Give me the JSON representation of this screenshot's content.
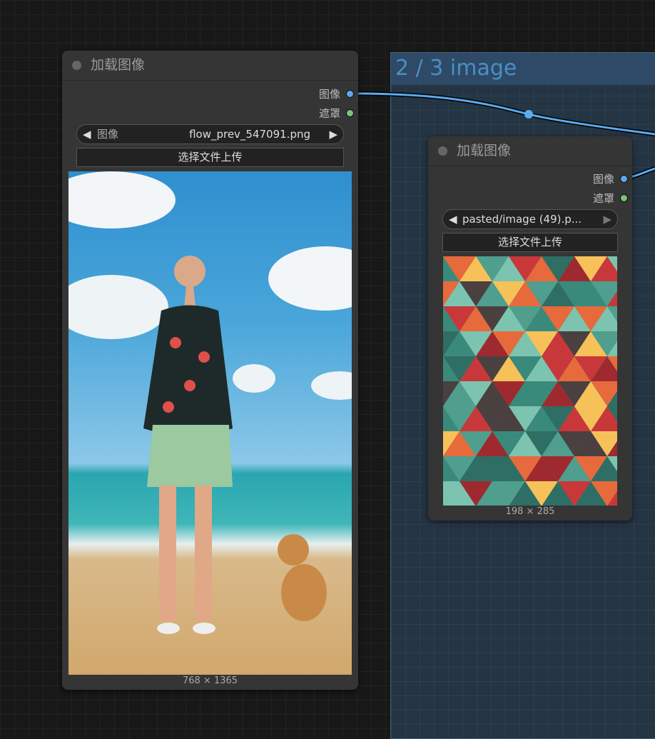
{
  "group": {
    "title": "2 / 3 image"
  },
  "nodes": [
    {
      "title": "加载图像",
      "outputs": [
        {
          "label": "图像",
          "color": "#5aaaf0"
        },
        {
          "label": "遮罩",
          "color": "#7cc47c"
        }
      ],
      "combo": {
        "label": "图像",
        "value": "flow_prev_547091.png"
      },
      "upload_label": "选择文件上传",
      "image_dims": "768 × 1365"
    },
    {
      "title": "加载图像",
      "outputs": [
        {
          "label": "图像",
          "color": "#5aaaf0"
        },
        {
          "label": "遮罩",
          "color": "#7cc47c"
        }
      ],
      "combo": {
        "value": "pasted/image (49).p..."
      },
      "upload_label": "选择文件上传",
      "image_dims": "198 × 285"
    }
  ],
  "link_color": "#5aaaf0"
}
